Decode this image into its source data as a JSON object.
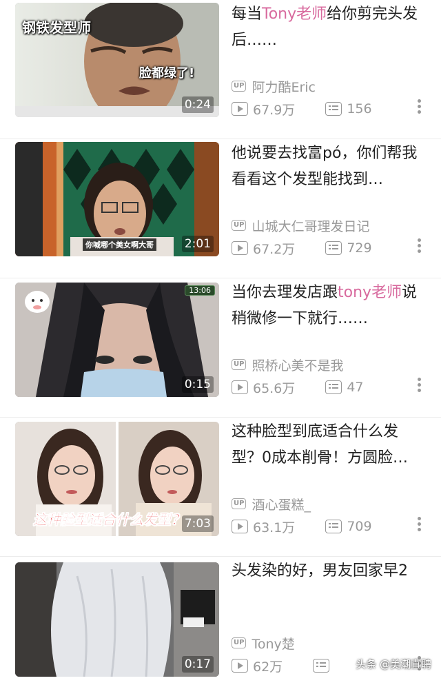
{
  "videos": [
    {
      "title_pre": "每当",
      "title_hl": "Tony老师",
      "title_post": "给你剪完头发后……",
      "duration": "0:24",
      "author": "阿力酷Eric",
      "views": "67.9万",
      "comments": "156",
      "overlay": [
        "钢铁发型师",
        "脸都绿了!"
      ]
    },
    {
      "title_pre": "他说要去找富pó，你们帮我看看这个发型能找到…",
      "title_hl": "",
      "title_post": "",
      "duration": "2:01",
      "author": "山城大仁哥理发日记",
      "views": "67.2万",
      "comments": "729",
      "overlay": [
        "你喊哪个美女啊大哥"
      ]
    },
    {
      "title_pre": "当你去理发店跟",
      "title_hl": "tony老师",
      "title_post": "说稍微修一下就行……",
      "duration": "0:15",
      "author": "照桥心美不是我",
      "views": "65.6万",
      "comments": "47",
      "overlay": [
        "13:06"
      ]
    },
    {
      "title_pre": "这种脸型到底适合什么发型？0成本削骨！方圆脸…",
      "title_hl": "",
      "title_post": "",
      "duration": "7:03",
      "author": "酒心蛋糕_",
      "views": "63.1万",
      "comments": "709",
      "overlay": [
        "这种脸型适合什么发型？"
      ]
    },
    {
      "title_pre": "头发染的好，男友回家早2",
      "title_hl": "",
      "title_post": "",
      "duration": "0:17",
      "author": "Tony楚",
      "views": "62万",
      "comments": "",
      "overlay": []
    }
  ],
  "up_badge": "UP",
  "watermark": "头条 @美潮直聘",
  "icons": {
    "views": "play-icon",
    "comments": "comment-icon",
    "more": "more-vertical-icon"
  },
  "colors": {
    "highlight": "#d86a9e",
    "meta": "#999999",
    "title": "#222222"
  }
}
